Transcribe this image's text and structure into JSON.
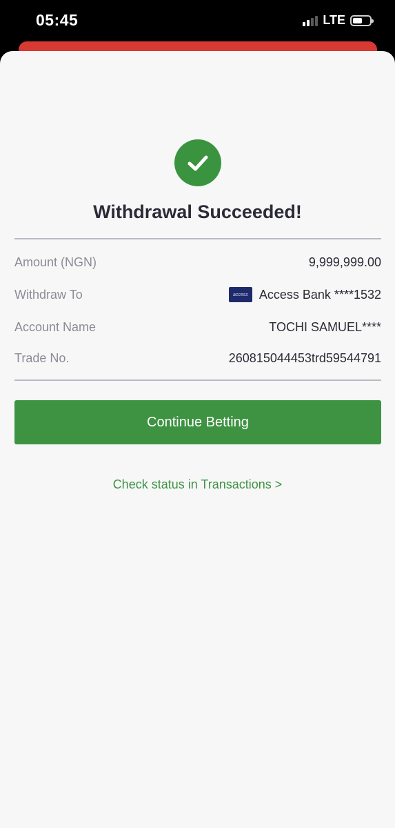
{
  "status_bar": {
    "time": "05:45",
    "network": "LTE"
  },
  "result": {
    "icon": "checkmark-circle-icon",
    "title": "Withdrawal Succeeded!"
  },
  "details": {
    "amount": {
      "label": "Amount (NGN)",
      "value": "9,999,999.00"
    },
    "withdraw_to": {
      "label": "Withdraw To",
      "bank_logo_text": "access",
      "value": "Access Bank ****1532"
    },
    "account_name": {
      "label": "Account Name",
      "value": "TOCHI SAMUEL****"
    },
    "trade_no": {
      "label": "Trade No.",
      "value": "260815044453trd59544791"
    }
  },
  "actions": {
    "continue_label": "Continue Betting",
    "transactions_link": "Check status in Transactions >"
  },
  "colors": {
    "success_green": "#3a943f",
    "button_green": "#3e9343",
    "header_red": "#d63a33",
    "bank_blue": "#1f2a6b"
  }
}
